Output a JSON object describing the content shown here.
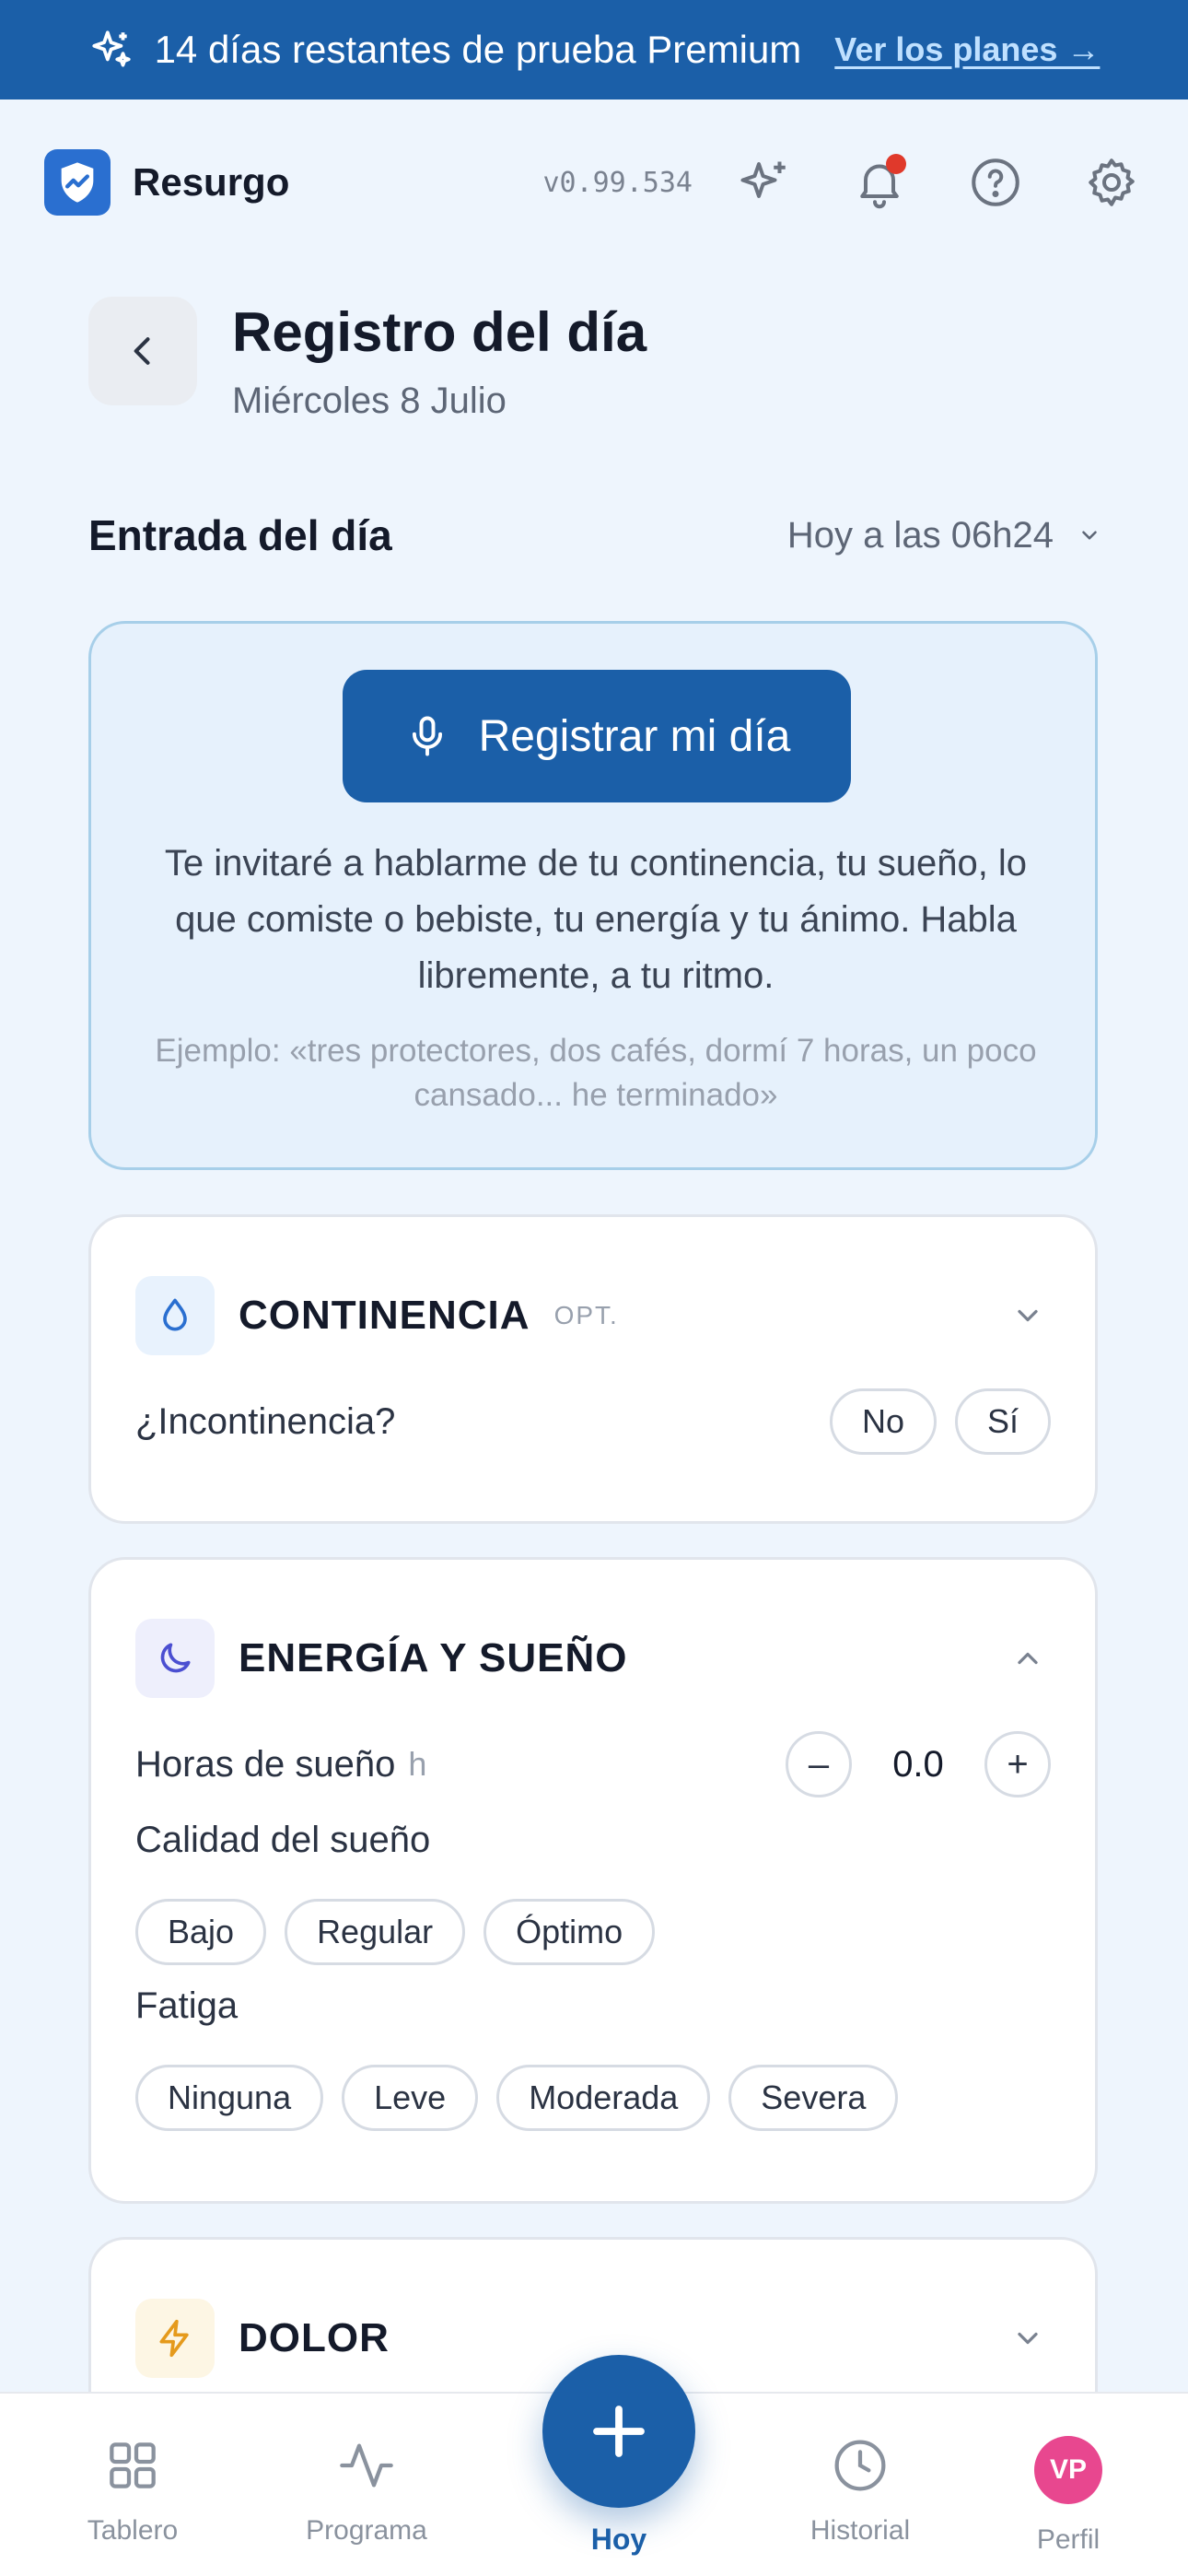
{
  "banner": {
    "text": "14 días restantes de prueba Premium",
    "link": "Ver los planes →"
  },
  "header": {
    "brand": "Resurgo",
    "version": "v0.99.534",
    "icons": [
      "sparkles-icon",
      "bell-icon",
      "help-icon",
      "gear-icon"
    ]
  },
  "page": {
    "title": "Registro del día",
    "subtitle": "Miércoles 8 Julio"
  },
  "entry": {
    "label": "Entrada del día",
    "time": "Hoy a las 06h24"
  },
  "voice": {
    "button": "Registrar mi día",
    "description": "Te invitaré a hablarme de tu continencia, tu sueño, lo que comiste o bebiste, tu energía y tu ánimo. Habla libremente, a tu ritmo.",
    "example": "Ejemplo: «tres protectores, dos cafés, dormí 7 horas, un poco cansado... he terminado»"
  },
  "continence": {
    "title": "CONTINENCIA",
    "tag": "OPT.",
    "question": "¿Incontinencia?",
    "options": [
      "No",
      "Sí"
    ]
  },
  "energy": {
    "title": "ENERGÍA Y SUEÑO",
    "sleep_hours_label": "Horas de sueño",
    "sleep_hours_unit": "h",
    "sleep_hours_value": "0.0",
    "minus": "–",
    "plus": "+",
    "quality_label": "Calidad del sueño",
    "quality_options": [
      "Bajo",
      "Regular",
      "Óptimo"
    ],
    "fatigue_label": "Fatiga",
    "fatigue_options": [
      "Ninguna",
      "Leve",
      "Moderada",
      "Severa"
    ]
  },
  "pain": {
    "title": "DOLOR"
  },
  "nav": {
    "items": [
      "Tablero",
      "Programa",
      "Hoy",
      "Historial",
      "Perfil"
    ],
    "avatar_initials": "VP"
  },
  "colors": {
    "primary": "#1b5fa8",
    "background": "#eef5fd",
    "notification": "#e0392b",
    "avatar": "#e8478f"
  }
}
